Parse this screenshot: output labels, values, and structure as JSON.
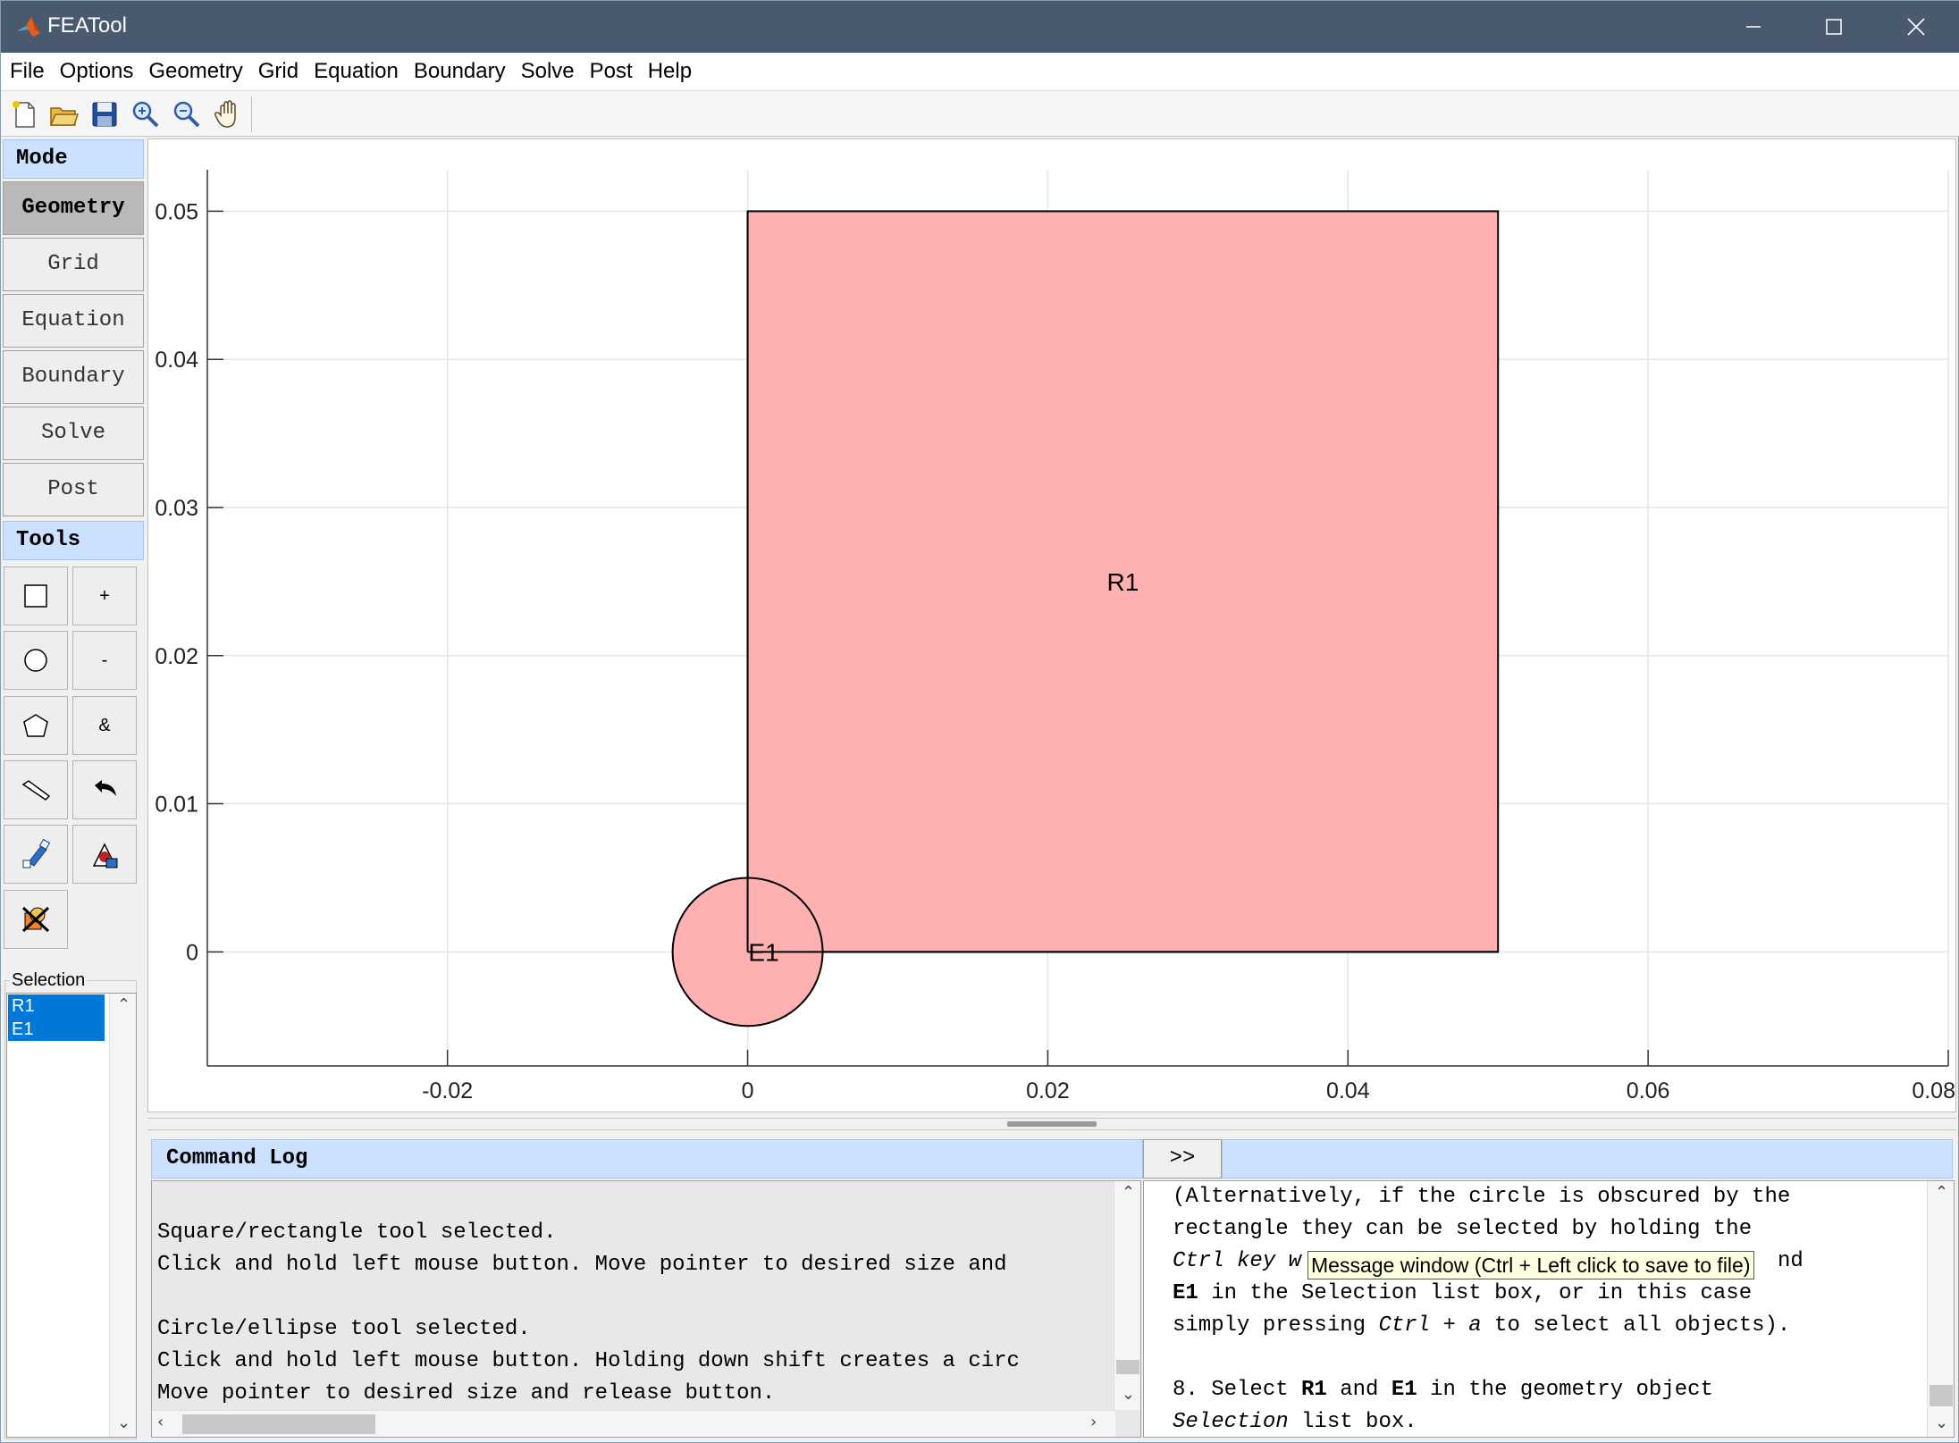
{
  "window": {
    "title": "FEATool",
    "minimize_icon": "minimize-icon",
    "maximize_icon": "maximize-icon",
    "close_icon": "close-icon"
  },
  "menu": [
    "File",
    "Options",
    "Geometry",
    "Grid",
    "Equation",
    "Boundary",
    "Solve",
    "Post",
    "Help"
  ],
  "toolbar": [
    "new-file-icon",
    "open-folder-icon",
    "save-icon",
    "zoom-in-icon",
    "zoom-out-icon",
    "pan-hand-icon"
  ],
  "mode": {
    "header": "Mode",
    "buttons": [
      "Geometry",
      "Grid",
      "Equation",
      "Boundary",
      "Solve",
      "Post"
    ],
    "active": "Geometry"
  },
  "tools": {
    "header": "Tools",
    "plus_label": "+",
    "minus_label": "-",
    "intersect_label": "&",
    "icons": [
      "rectangle-icon",
      "circle-icon",
      "polygon-icon",
      "line-icon",
      "undo-icon",
      "edit-object-icon",
      "transform-icon",
      "delete-objects-icon"
    ]
  },
  "selection": {
    "label": "Selection",
    "items": [
      "R1",
      "E1"
    ]
  },
  "chart_data": {
    "type": "scatter",
    "title": "",
    "xlabel": "",
    "ylabel": "",
    "xlim": [
      -0.036,
      0.08
    ],
    "ylim": [
      -0.0077,
      0.0528
    ],
    "xticks": [
      -0.02,
      0,
      0.02,
      0.04,
      0.06,
      0.08
    ],
    "xtick_labels": [
      "-0.02",
      "0",
      "0.02",
      "0.04",
      "0.06",
      "0.08"
    ],
    "yticks": [
      0,
      0.01,
      0.02,
      0.03,
      0.04,
      0.05
    ],
    "ytick_labels": [
      "0",
      "0.01",
      "0.02",
      "0.03",
      "0.04",
      "0.05"
    ],
    "grid": true,
    "fill_color": "#ffb0b0",
    "objects": [
      {
        "label": "R1",
        "shape": "rectangle",
        "x": [
          0,
          0.05
        ],
        "y": [
          0,
          0.05
        ]
      },
      {
        "label": "E1",
        "shape": "ellipse",
        "center": [
          0,
          0
        ],
        "radius": 0.005
      }
    ]
  },
  "command_log": {
    "header": "Command Log",
    "lines": [
      "Square/rectangle tool selected.",
      "Click and hold left mouse button. Move pointer to desired size and",
      "",
      "Circle/ellipse tool selected.",
      "Click and hold left mouse button. Holding down shift creates a circ",
      "Move pointer to desired size and release button."
    ]
  },
  "message": {
    "toggle_label": ">>",
    "lines": [
      "(Alternatively, if the circle is obscured by the",
      "rectangle they can be selected by holding the",
      "Ctrl key w",
      "nd",
      "E1",
      " in the Selection list box, or in this case",
      "simply pressing ",
      "Ctrl + a",
      " to select all objects).",
      "8. Select ",
      "R1",
      " and ",
      "E1",
      " in the geometry object",
      "Selection",
      " list box."
    ],
    "tooltip": "Message window (Ctrl + Left click to save to file)"
  }
}
